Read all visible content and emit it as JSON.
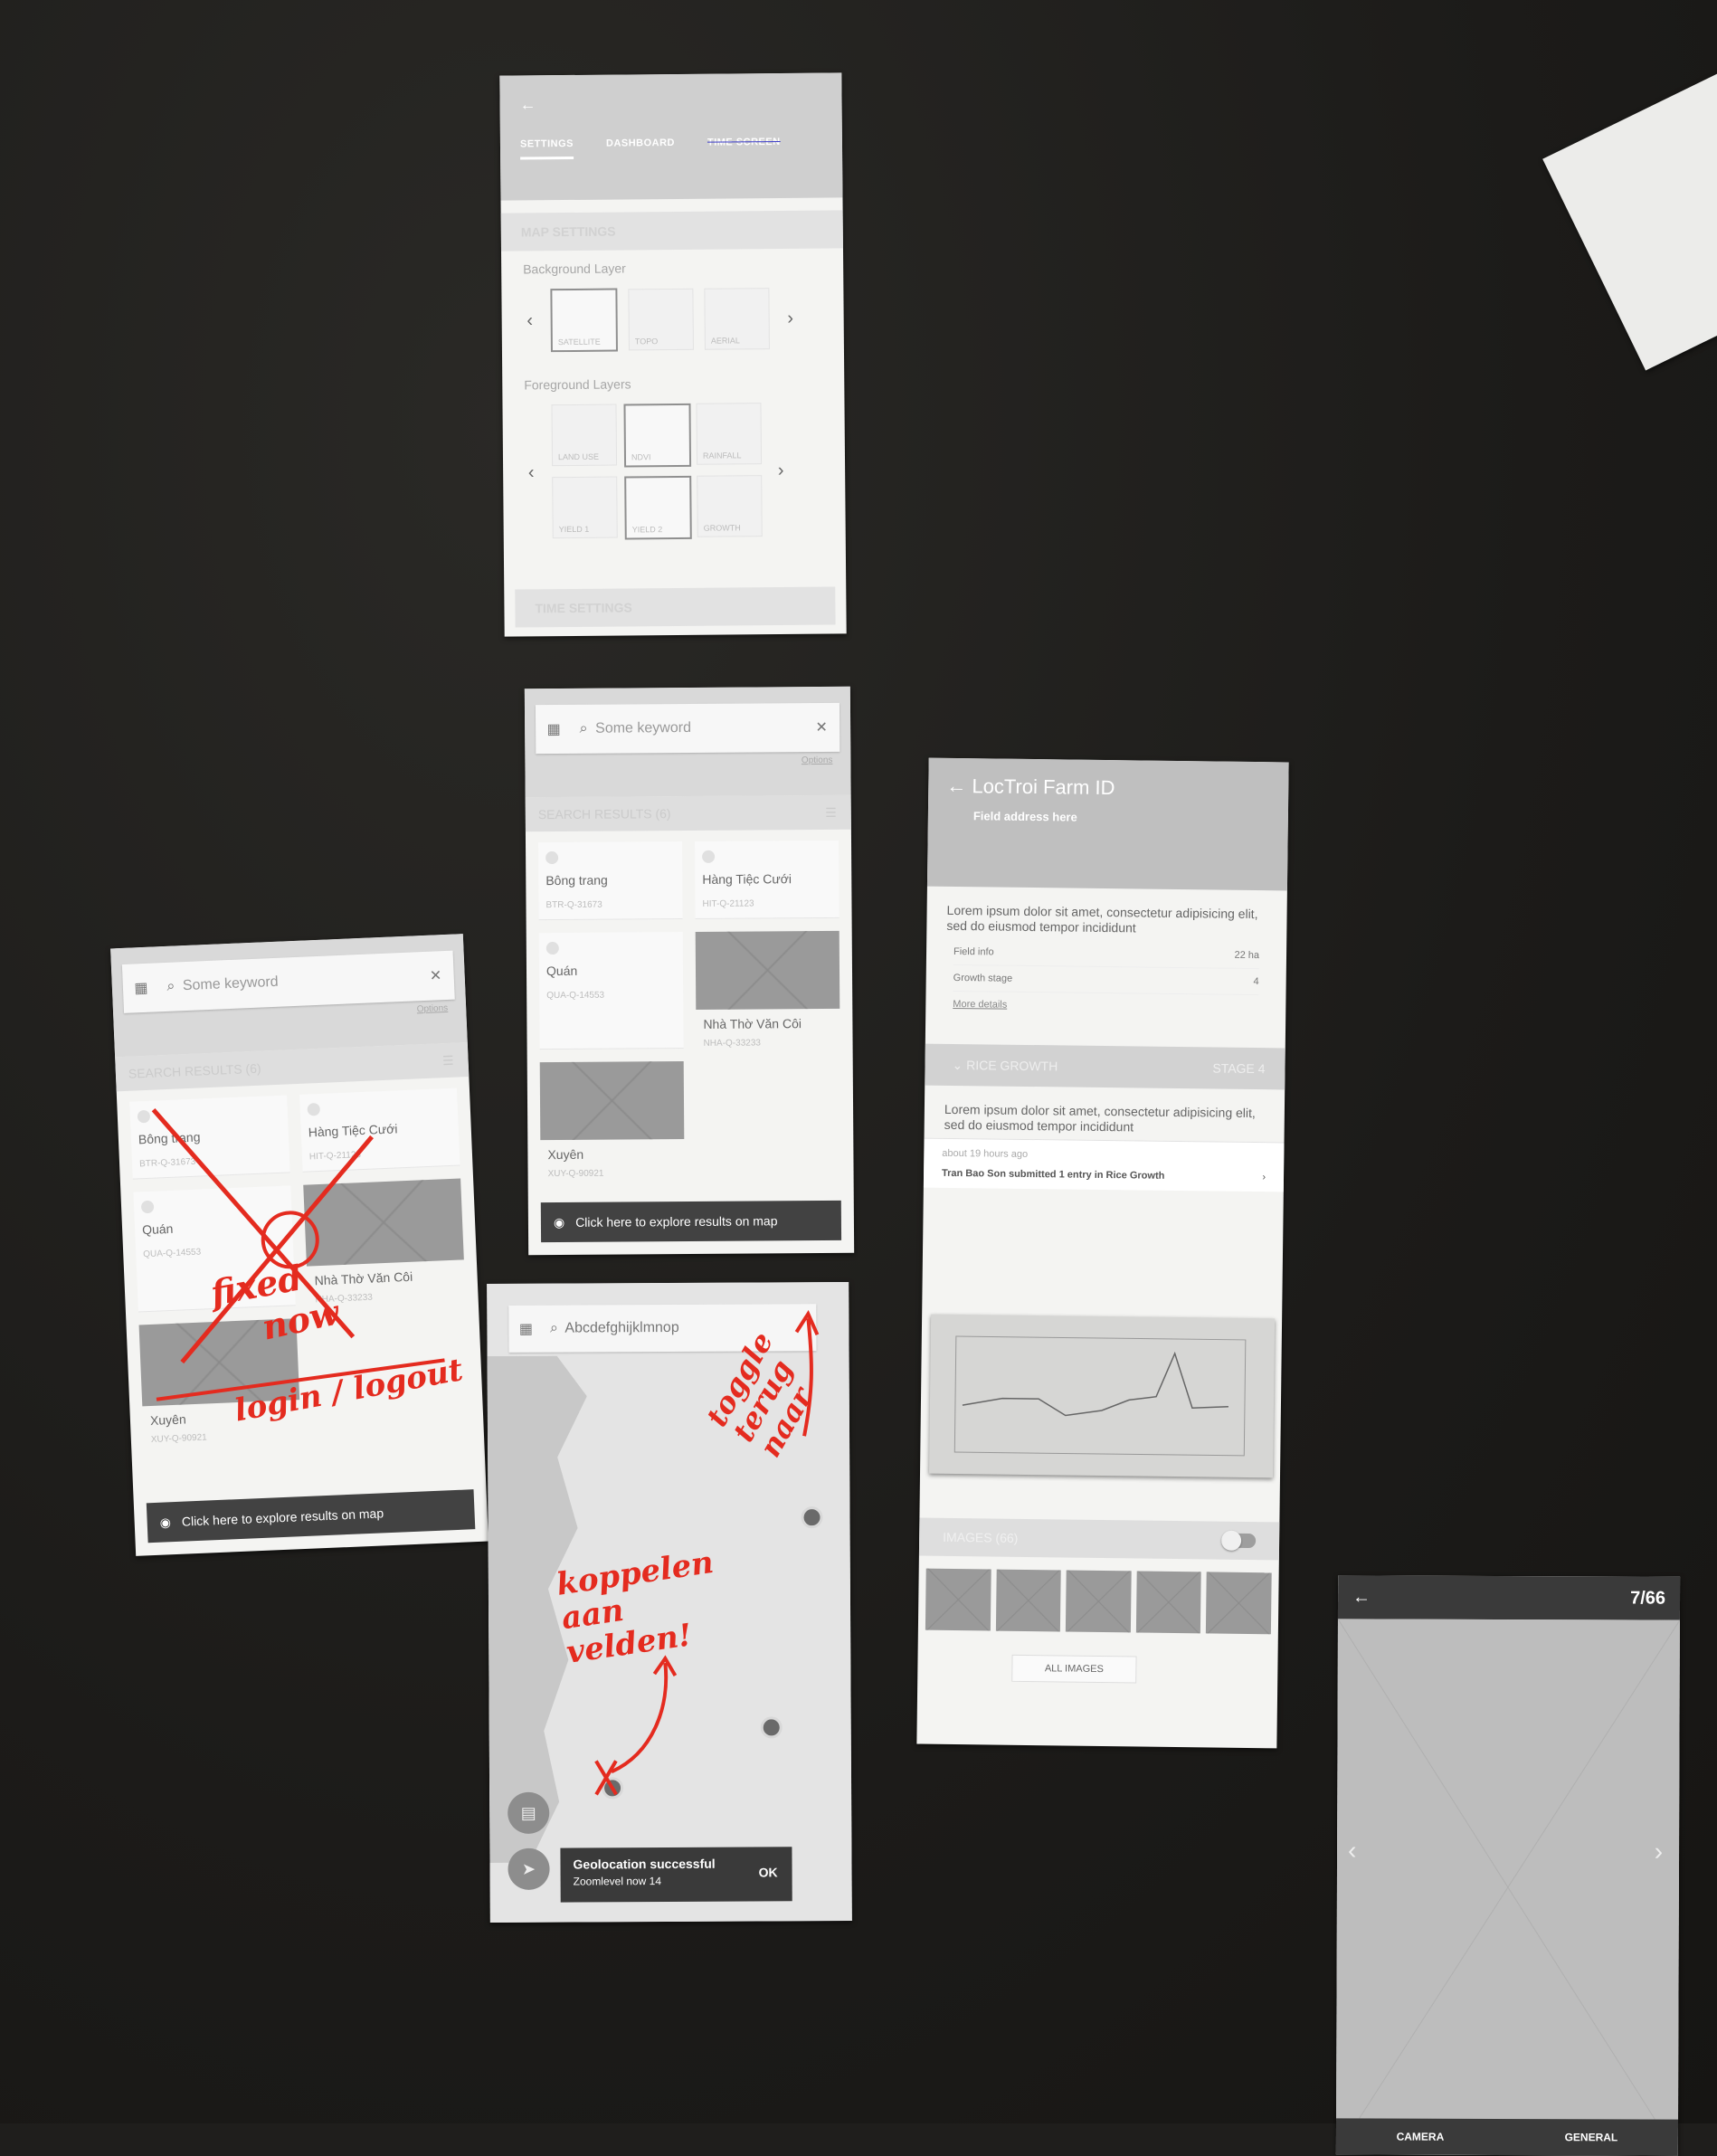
{
  "settings": {
    "tabs": [
      "SETTINGS",
      "DASHBOARD",
      "TIME SCREEN"
    ],
    "map_settings": "MAP SETTINGS",
    "background_label": "Background Layer",
    "background_tiles": [
      "SATELLITE",
      "TOPO",
      "AERIAL"
    ],
    "foreground_label": "Foreground Layers",
    "foreground_tiles": [
      "LAND USE",
      "NDVI",
      "RAINFALL",
      "YIELD 1",
      "YIELD 2",
      "GROWTH"
    ],
    "time_settings": "TIME SETTINGS"
  },
  "search": {
    "placeholder": "Some keyword",
    "options": "Options",
    "results_label": "SEARCH RESULTS (6)",
    "results": [
      {
        "name": "Bông trang",
        "code": "BTR-Q-31673"
      },
      {
        "name": "Hàng Tiệc Cưới",
        "code": "HIT-Q-21123"
      },
      {
        "name": "Quán",
        "code": "QUA-Q-14553"
      },
      {
        "name": "Nhà Thờ Văn Côi",
        "code": "NHA-Q-33233"
      },
      {
        "name": "Xuyên",
        "code": "XUY-Q-90921"
      }
    ],
    "explore": "Click here to explore results on map"
  },
  "map": {
    "query": "Abcdefghijklmnop",
    "toast_title": "Geolocation successful",
    "toast_sub": "Zoomlevel now 14",
    "toast_ok": "OK"
  },
  "farm": {
    "title": "LocTroi Farm ID",
    "subtitle": "Field address here",
    "lorem": "Lorem ipsum dolor sit amet, consectetur adipisicing elit, sed do eiusmod tempor incididunt",
    "field_info_label": "Field info",
    "field_info_value": "22 ha",
    "growth_label": "Growth stage",
    "growth_value": "4",
    "more": "More details",
    "rice_growth": "RICE GROWTH",
    "stage": "STAGE 4",
    "feed_time": "about 19 hours ago",
    "feed_text": "Tran Bao Son submitted 1 entry in Rice Growth",
    "images_label": "IMAGES (66)",
    "all_images": "ALL IMAGES"
  },
  "photo": {
    "counter": "7/66",
    "tab_camera": "CAMERA",
    "tab_general": "GENERAL"
  },
  "handwriting": {
    "a": "fixed",
    "b": "now",
    "c": "login / logout",
    "d": "toggle terug naar",
    "e": "koppelen aan velden!"
  },
  "colors": {
    "ink_red": "#e42b1f",
    "paper": "#f4f4f2",
    "desk": "#1f1e1c"
  }
}
